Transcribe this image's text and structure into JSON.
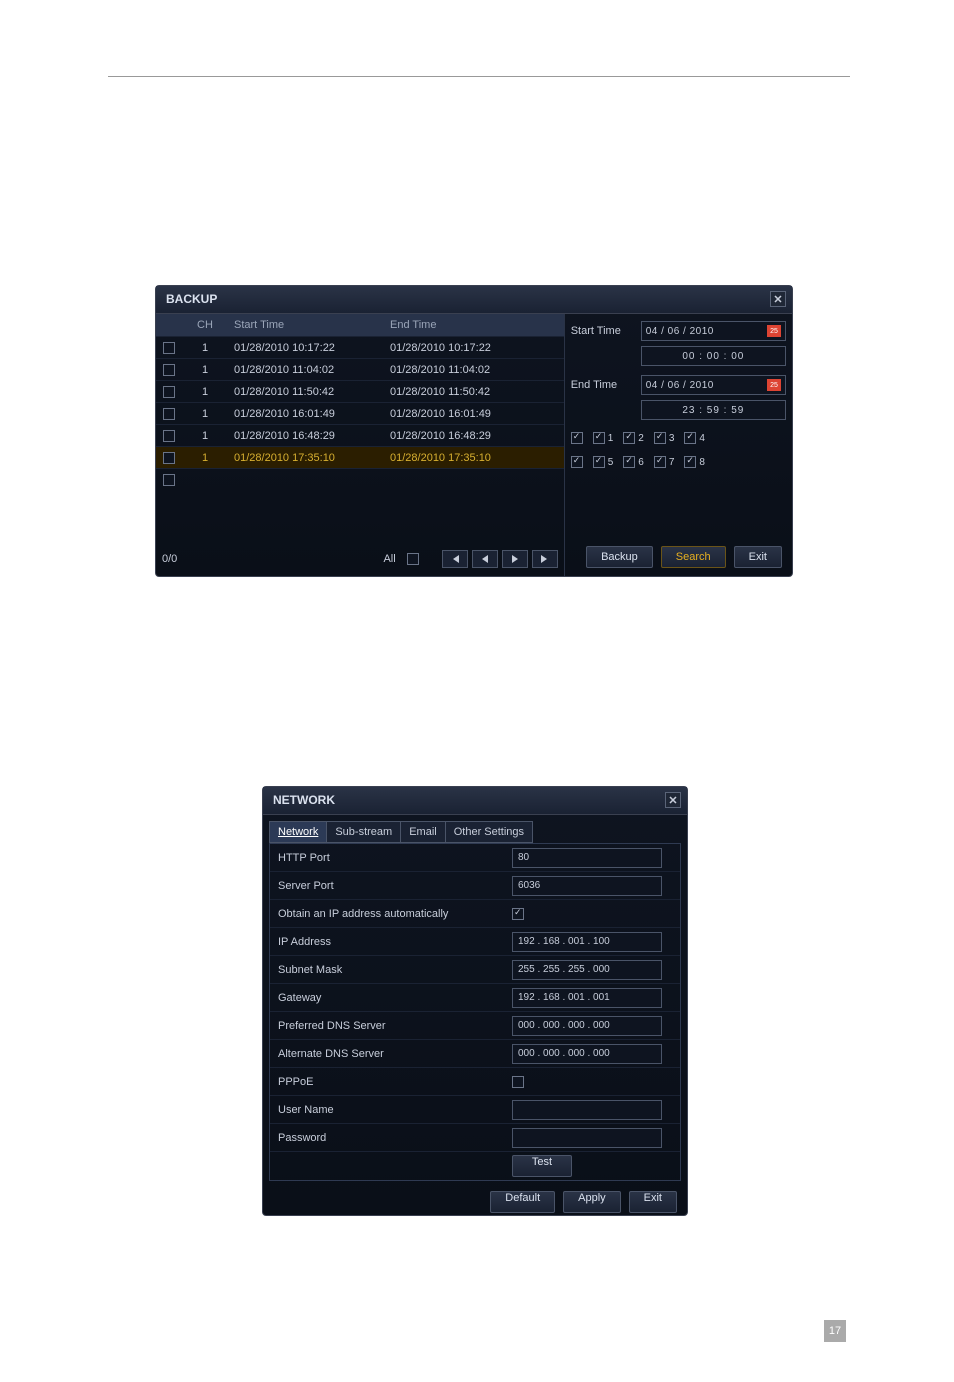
{
  "backup": {
    "title": "BACKUP",
    "columns": {
      "ch": "CH",
      "start": "Start Time",
      "end": "End Time"
    },
    "rows": [
      {
        "ch": "1",
        "start": "01/28/2010 10:17:22",
        "end": "01/28/2010 10:17:22"
      },
      {
        "ch": "1",
        "start": "01/28/2010 11:04:02",
        "end": "01/28/2010 11:04:02"
      },
      {
        "ch": "1",
        "start": "01/28/2010 11:50:42",
        "end": "01/28/2010 11:50:42"
      },
      {
        "ch": "1",
        "start": "01/28/2010 16:01:49",
        "end": "01/28/2010 16:01:49"
      },
      {
        "ch": "1",
        "start": "01/28/2010 16:48:29",
        "end": "01/28/2010 16:48:29"
      },
      {
        "ch": "1",
        "start": "01/28/2010 17:35:10",
        "end": "01/28/2010 17:35:10"
      }
    ],
    "pager": {
      "count": "0/0",
      "all": "All"
    },
    "start_label": "Start Time",
    "end_label": "End Time",
    "start_date": "04 / 06 / 2010",
    "start_time": "00 : 00 : 00",
    "end_date": "04 / 06 / 2010",
    "end_time": "23 : 59 : 59",
    "cal": "25",
    "channels_row1": [
      "1",
      "2",
      "3",
      "4"
    ],
    "channels_row2": [
      "5",
      "6",
      "7",
      "8"
    ],
    "btn_backup": "Backup",
    "btn_search": "Search",
    "btn_exit": "Exit"
  },
  "network": {
    "title": "NETWORK",
    "tabs": [
      "Network",
      "Sub-stream",
      "Email",
      "Other Settings"
    ],
    "fields": {
      "http_port": {
        "label": "HTTP Port",
        "value": "80"
      },
      "server_port": {
        "label": "Server Port",
        "value": "6036"
      },
      "auto_ip": {
        "label": "Obtain an IP address automatically"
      },
      "ip": {
        "label": "IP Address",
        "value": "192 . 168 . 001 . 100"
      },
      "subnet": {
        "label": "Subnet Mask",
        "value": "255 . 255 . 255 . 000"
      },
      "gateway": {
        "label": "Gateway",
        "value": "192 . 168 . 001 . 001"
      },
      "pdns": {
        "label": "Preferred DNS Server",
        "value": "000 . 000 . 000 . 000"
      },
      "adns": {
        "label": "Alternate DNS Server",
        "value": "000 . 000 . 000 . 000"
      },
      "pppoe": {
        "label": "PPPoE"
      },
      "user": {
        "label": "User Name",
        "value": ""
      },
      "pass": {
        "label": "Password",
        "value": ""
      },
      "test": "Test"
    },
    "btn_default": "Default",
    "btn_apply": "Apply",
    "btn_exit": "Exit"
  },
  "page_number": "17"
}
